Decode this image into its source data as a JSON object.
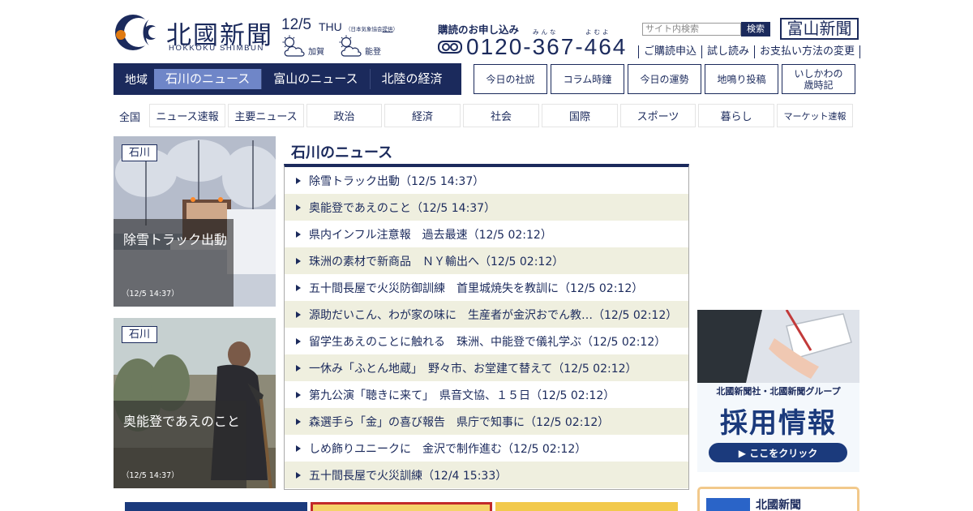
{
  "header": {
    "logo_text": "北國新聞",
    "logo_en": "HOKKOKU SHIMBUN",
    "date": "12/5",
    "weekday": "THU",
    "weather_credit_prefix": "（日本気象協会",
    "weather_credit_link": "提供",
    "weather_credit_suffix": "）",
    "weather": [
      {
        "region": "加賀",
        "icon": "cloudy-sun-icon"
      },
      {
        "region": "能登",
        "icon": "cloudy-sun-icon"
      }
    ]
  },
  "subscription": {
    "title": "購読のお申し込み",
    "ruby_minna": "みんな",
    "ruby_yomuyo": "よむよ",
    "phone": "0120-367-464",
    "links": [
      "ご購読申込",
      "試し読み",
      "お支払い方法の変更"
    ]
  },
  "search": {
    "placeholder": "サイト内検索",
    "button_label": "検索"
  },
  "toyama_button": "富山新聞",
  "region_nav": {
    "label": "地域",
    "tabs": [
      "石川のニュース",
      "富山のニュース",
      "北陸の経済"
    ],
    "active_index": 0
  },
  "column_buttons": [
    "今日の社説",
    "コラム時鐘",
    "今日の運勢",
    "地鳴り投稿",
    "いしかわの歳時記"
  ],
  "categories": {
    "all_label": "全国",
    "items": [
      "ニュース速報",
      "主要ニュース",
      "政治",
      "経済",
      "社会",
      "国際",
      "スポーツ",
      "暮らし",
      "マーケット速報"
    ]
  },
  "features": [
    {
      "tag": "石川",
      "title": "除雪トラック出動",
      "time": "（12/5 14:37）"
    },
    {
      "tag": "石川",
      "title": "奥能登であえのこと",
      "time": "（12/5 14:37）"
    }
  ],
  "news_list": {
    "heading": "石川のニュース",
    "items": [
      "除雪トラック出動（12/5 14:37）",
      "奥能登であえのこと（12/5 14:37）",
      "県内インフル注意報　過去最速（12/5 02:12）",
      "珠洲の素材で新商品　ＮＹ輸出へ（12/5 02:12）",
      "五十間長屋で火災防御訓練　首里城焼失を教訓に（12/5 02:12）",
      "源助だいこん、わが家の味に　生産者が金沢おでん教…（12/5 02:12）",
      "留学生あえのことに触れる　珠洲、中能登で儀礼学ぶ（12/5 02:12）",
      "一休み「ふとん地蔵」　野々市、お堂建て替えて（12/5 02:12）",
      "第九公演「聴きに来て」　県音文協、１５日（12/5 02:12）",
      "森選手ら「金」の喜び報告　県庁で知事に（12/5 02:12）",
      "しめ飾りユニークに　金沢で制作進む（12/5 02:12）",
      "五十間長屋で火災訓練（12/4 15:33）"
    ]
  },
  "recruit_banner": {
    "subtitle": "北國新聞社・北國新聞グループ",
    "title": "採用情報",
    "button": "▶ ここをクリック"
  },
  "bottom_box": {
    "name": "北國新聞"
  },
  "colors": {
    "navy": "#1b2a5c",
    "active_tab": "#6f86c8",
    "stripe": "#efefdf",
    "banner_border": "#f2c98b"
  }
}
